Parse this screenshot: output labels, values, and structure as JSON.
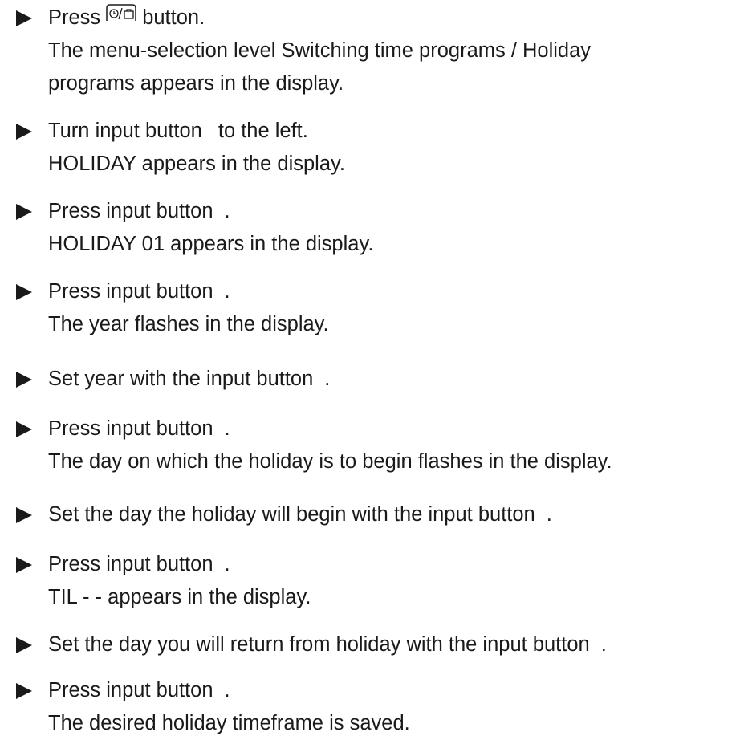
{
  "steps": [
    {
      "action_before": "Press",
      "action_after": "button.",
      "button_icon": "clock-suitcase-icon",
      "result": [
        "The menu-selection level Switching time programs / Holiday",
        "programs appears in the display."
      ]
    },
    {
      "action_before": "Turn input button",
      "action_after": "to the left.",
      "result": [
        "HOLIDAY appears in the display."
      ]
    },
    {
      "action_before": "Press input button",
      "action_after": ".",
      "result": [
        "HOLIDAY 01 appears in the display."
      ]
    },
    {
      "action_before": "Press input button",
      "action_after": ".",
      "result": [
        "The year flashes in the display."
      ]
    },
    {
      "action_before": "Set year with the input button",
      "action_after": ".",
      "result": []
    },
    {
      "action_before": "Press input button",
      "action_after": ".",
      "result": [
        "The day on which the holiday is to begin flashes in the display."
      ]
    },
    {
      "action_before": "Set the day the holiday will begin with the input button",
      "action_after": ".",
      "result": []
    },
    {
      "action_before": "Press input button",
      "action_after": ".",
      "result": [
        "TIL - - appears in the display."
      ]
    },
    {
      "action_before": "Set the day you will return from holiday with the input button",
      "action_after": ".",
      "result": []
    },
    {
      "action_before": "Press input button",
      "action_after": ".",
      "result": [
        "The desired holiday timeframe is saved."
      ]
    }
  ]
}
